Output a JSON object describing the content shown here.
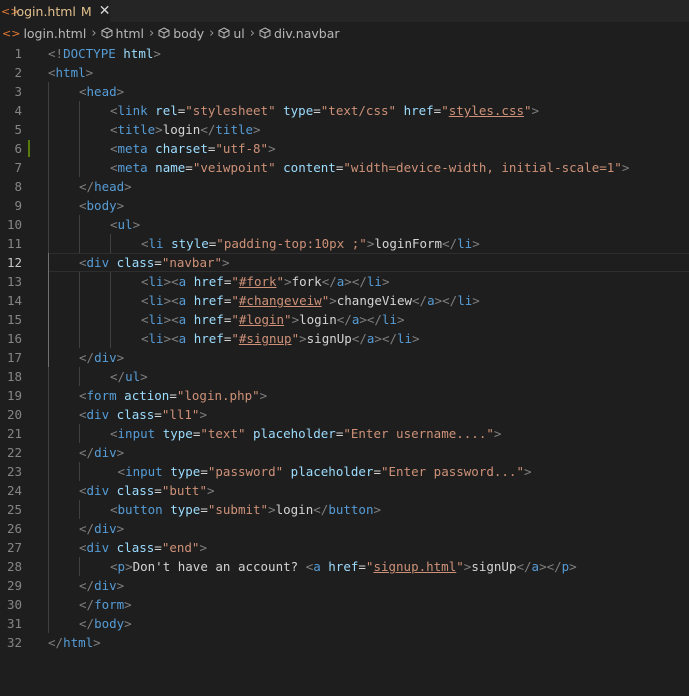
{
  "tab": {
    "icon": "<>",
    "filename": "login.html",
    "status": "M",
    "close": "✕"
  },
  "breadcrumbs": [
    {
      "icon": "html-file-icon",
      "label": "login.html"
    },
    {
      "icon": "cube-icon",
      "label": "html"
    },
    {
      "icon": "cube-icon",
      "label": "body"
    },
    {
      "icon": "cube-icon",
      "label": "ul"
    },
    {
      "icon": "cube-icon",
      "label": "div.navbar"
    }
  ],
  "active_line": 12,
  "modified_lines": [
    6
  ],
  "colors": {
    "tag": "#569cd6",
    "bracket": "#808080",
    "attr": "#9cdcfe",
    "string": "#ce9178",
    "text": "#d4d4d4",
    "background": "#1e1e1e"
  },
  "lines": [
    {
      "num": "1",
      "indent": 0,
      "tokens": [
        [
          "br",
          "<!"
        ],
        [
          "tag",
          "DOCTYPE"
        ],
        [
          "txt",
          " "
        ],
        [
          "attr",
          "html"
        ],
        [
          "br",
          ">"
        ]
      ]
    },
    {
      "num": "2",
      "indent": 0,
      "tokens": [
        [
          "br",
          "<"
        ],
        [
          "tag",
          "html"
        ],
        [
          "br",
          ">"
        ]
      ]
    },
    {
      "num": "3",
      "indent": 1,
      "tokens": [
        [
          "br",
          "<"
        ],
        [
          "tag",
          "head"
        ],
        [
          "br",
          ">"
        ]
      ]
    },
    {
      "num": "4",
      "indent": 2,
      "tokens": [
        [
          "br",
          "<"
        ],
        [
          "tag",
          "link"
        ],
        [
          "txt",
          " "
        ],
        [
          "attr",
          "rel"
        ],
        [
          "txt",
          "="
        ],
        [
          "str",
          "\"stylesheet\""
        ],
        [
          "txt",
          " "
        ],
        [
          "attr",
          "type"
        ],
        [
          "txt",
          "="
        ],
        [
          "str",
          "\"text/css\""
        ],
        [
          "txt",
          " "
        ],
        [
          "attr",
          "href"
        ],
        [
          "txt",
          "="
        ],
        [
          "str",
          "\""
        ],
        [
          "link",
          "styles.css"
        ],
        [
          "str",
          "\""
        ],
        [
          "br",
          ">"
        ]
      ]
    },
    {
      "num": "5",
      "indent": 2,
      "tokens": [
        [
          "br",
          "<"
        ],
        [
          "tag",
          "title"
        ],
        [
          "br",
          ">"
        ],
        [
          "txt",
          "login"
        ],
        [
          "br",
          "</"
        ],
        [
          "tag",
          "title"
        ],
        [
          "br",
          ">"
        ]
      ]
    },
    {
      "num": "6",
      "indent": 2,
      "tokens": [
        [
          "br",
          "<"
        ],
        [
          "tag",
          "meta"
        ],
        [
          "txt",
          " "
        ],
        [
          "attr",
          "charset"
        ],
        [
          "txt",
          "="
        ],
        [
          "str",
          "\"utf-8\""
        ],
        [
          "br",
          ">"
        ]
      ]
    },
    {
      "num": "7",
      "indent": 2,
      "tokens": [
        [
          "br",
          "<"
        ],
        [
          "tag",
          "meta"
        ],
        [
          "txt",
          " "
        ],
        [
          "attr",
          "name"
        ],
        [
          "txt",
          "="
        ],
        [
          "str",
          "\"veiwpoint\""
        ],
        [
          "txt",
          " "
        ],
        [
          "attr",
          "content"
        ],
        [
          "txt",
          "="
        ],
        [
          "str",
          "\"width=device-width, initial-scale=1\""
        ],
        [
          "br",
          ">"
        ]
      ]
    },
    {
      "num": "8",
      "indent": 1,
      "tokens": [
        [
          "br",
          "</"
        ],
        [
          "tag",
          "head"
        ],
        [
          "br",
          ">"
        ]
      ]
    },
    {
      "num": "9",
      "indent": 1,
      "tokens": [
        [
          "br",
          "<"
        ],
        [
          "tag",
          "body"
        ],
        [
          "br",
          ">"
        ]
      ]
    },
    {
      "num": "10",
      "indent": 2,
      "tokens": [
        [
          "br",
          "<"
        ],
        [
          "tag",
          "ul"
        ],
        [
          "br",
          ">"
        ]
      ]
    },
    {
      "num": "11",
      "indent": 3,
      "tokens": [
        [
          "br",
          "<"
        ],
        [
          "tag",
          "li"
        ],
        [
          "txt",
          " "
        ],
        [
          "attr",
          "style"
        ],
        [
          "txt",
          "="
        ],
        [
          "str",
          "\"padding-top:10px ;\""
        ],
        [
          "br",
          ">"
        ],
        [
          "txt",
          "loginForm"
        ],
        [
          "br",
          "</"
        ],
        [
          "tag",
          "li"
        ],
        [
          "br",
          ">"
        ]
      ]
    },
    {
      "num": "12",
      "indent": 1,
      "tokens": [
        [
          "br",
          "<"
        ],
        [
          "tag",
          "div"
        ],
        [
          "txt",
          " "
        ],
        [
          "attr",
          "class"
        ],
        [
          "txt",
          "="
        ],
        [
          "str",
          "\"navbar\""
        ],
        [
          "br",
          ">"
        ]
      ]
    },
    {
      "num": "13",
      "indent": 3,
      "tokens": [
        [
          "br",
          "<"
        ],
        [
          "tag",
          "li"
        ],
        [
          "br",
          "><"
        ],
        [
          "tag",
          "a"
        ],
        [
          "txt",
          " "
        ],
        [
          "attr",
          "href"
        ],
        [
          "txt",
          "="
        ],
        [
          "str",
          "\""
        ],
        [
          "link",
          "#fork"
        ],
        [
          "str",
          "\""
        ],
        [
          "br",
          ">"
        ],
        [
          "txt",
          "fork"
        ],
        [
          "br",
          "</"
        ],
        [
          "tag",
          "a"
        ],
        [
          "br",
          "></"
        ],
        [
          "tag",
          "li"
        ],
        [
          "br",
          ">"
        ]
      ]
    },
    {
      "num": "14",
      "indent": 3,
      "tokens": [
        [
          "br",
          "<"
        ],
        [
          "tag",
          "li"
        ],
        [
          "br",
          "><"
        ],
        [
          "tag",
          "a"
        ],
        [
          "txt",
          " "
        ],
        [
          "attr",
          "href"
        ],
        [
          "txt",
          "="
        ],
        [
          "str",
          "\""
        ],
        [
          "link",
          "#changeveiw"
        ],
        [
          "str",
          "\""
        ],
        [
          "br",
          ">"
        ],
        [
          "txt",
          "changeView"
        ],
        [
          "br",
          "</"
        ],
        [
          "tag",
          "a"
        ],
        [
          "br",
          "></"
        ],
        [
          "tag",
          "li"
        ],
        [
          "br",
          ">"
        ]
      ]
    },
    {
      "num": "15",
      "indent": 3,
      "tokens": [
        [
          "br",
          "<"
        ],
        [
          "tag",
          "li"
        ],
        [
          "br",
          "><"
        ],
        [
          "tag",
          "a"
        ],
        [
          "txt",
          " "
        ],
        [
          "attr",
          "href"
        ],
        [
          "txt",
          "="
        ],
        [
          "str",
          "\""
        ],
        [
          "link",
          "#login"
        ],
        [
          "str",
          "\""
        ],
        [
          "br",
          ">"
        ],
        [
          "txt",
          "login"
        ],
        [
          "br",
          "</"
        ],
        [
          "tag",
          "a"
        ],
        [
          "br",
          "></"
        ],
        [
          "tag",
          "li"
        ],
        [
          "br",
          ">"
        ]
      ]
    },
    {
      "num": "16",
      "indent": 3,
      "tokens": [
        [
          "br",
          "<"
        ],
        [
          "tag",
          "li"
        ],
        [
          "br",
          "><"
        ],
        [
          "tag",
          "a"
        ],
        [
          "txt",
          " "
        ],
        [
          "attr",
          "href"
        ],
        [
          "txt",
          "="
        ],
        [
          "str",
          "\""
        ],
        [
          "link",
          "#signup"
        ],
        [
          "str",
          "\""
        ],
        [
          "br",
          ">"
        ],
        [
          "txt",
          "signUp"
        ],
        [
          "br",
          "</"
        ],
        [
          "tag",
          "a"
        ],
        [
          "br",
          "></"
        ],
        [
          "tag",
          "li"
        ],
        [
          "br",
          ">"
        ]
      ]
    },
    {
      "num": "17",
      "indent": 1,
      "tokens": [
        [
          "br",
          "</"
        ],
        [
          "tag",
          "div"
        ],
        [
          "br",
          ">"
        ]
      ]
    },
    {
      "num": "18",
      "indent": 2,
      "tokens": [
        [
          "br",
          "</"
        ],
        [
          "tag",
          "ul"
        ],
        [
          "br",
          ">"
        ]
      ]
    },
    {
      "num": "19",
      "indent": 1,
      "tokens": [
        [
          "br",
          "<"
        ],
        [
          "tag",
          "form"
        ],
        [
          "txt",
          " "
        ],
        [
          "attr",
          "action"
        ],
        [
          "txt",
          "="
        ],
        [
          "str",
          "\"login.php\""
        ],
        [
          "br",
          ">"
        ]
      ]
    },
    {
      "num": "20",
      "indent": 1,
      "tokens": [
        [
          "br",
          "<"
        ],
        [
          "tag",
          "div"
        ],
        [
          "txt",
          " "
        ],
        [
          "attr",
          "class"
        ],
        [
          "txt",
          "="
        ],
        [
          "str",
          "\"ll1\""
        ],
        [
          "br",
          ">"
        ]
      ]
    },
    {
      "num": "21",
      "indent": 2,
      "tokens": [
        [
          "br",
          "<"
        ],
        [
          "tag",
          "input"
        ],
        [
          "txt",
          " "
        ],
        [
          "attr",
          "type"
        ],
        [
          "txt",
          "="
        ],
        [
          "str",
          "\"text\""
        ],
        [
          "txt",
          " "
        ],
        [
          "attr",
          "placeholder"
        ],
        [
          "txt",
          "="
        ],
        [
          "str",
          "\"Enter username....\""
        ],
        [
          "br",
          ">"
        ]
      ]
    },
    {
      "num": "22",
      "indent": 1,
      "tokens": [
        [
          "br",
          "</"
        ],
        [
          "tag",
          "div"
        ],
        [
          "br",
          ">"
        ]
      ]
    },
    {
      "num": "23",
      "indent": 2,
      "tokens": [
        [
          "txt",
          " "
        ],
        [
          "br",
          "<"
        ],
        [
          "tag",
          "input"
        ],
        [
          "txt",
          " "
        ],
        [
          "attr",
          "type"
        ],
        [
          "txt",
          "="
        ],
        [
          "str",
          "\"password\""
        ],
        [
          "txt",
          " "
        ],
        [
          "attr",
          "placeholder"
        ],
        [
          "txt",
          "="
        ],
        [
          "str",
          "\"Enter password...\""
        ],
        [
          "br",
          ">"
        ]
      ]
    },
    {
      "num": "24",
      "indent": 1,
      "tokens": [
        [
          "br",
          "<"
        ],
        [
          "tag",
          "div"
        ],
        [
          "txt",
          " "
        ],
        [
          "attr",
          "class"
        ],
        [
          "txt",
          "="
        ],
        [
          "str",
          "\"butt\""
        ],
        [
          "br",
          ">"
        ]
      ]
    },
    {
      "num": "25",
      "indent": 2,
      "tokens": [
        [
          "br",
          "<"
        ],
        [
          "tag",
          "button"
        ],
        [
          "txt",
          " "
        ],
        [
          "attr",
          "type"
        ],
        [
          "txt",
          "="
        ],
        [
          "str",
          "\"submit\""
        ],
        [
          "br",
          ">"
        ],
        [
          "txt",
          "login"
        ],
        [
          "br",
          "</"
        ],
        [
          "tag",
          "button"
        ],
        [
          "br",
          ">"
        ]
      ]
    },
    {
      "num": "26",
      "indent": 1,
      "tokens": [
        [
          "br",
          "</"
        ],
        [
          "tag",
          "div"
        ],
        [
          "br",
          ">"
        ]
      ]
    },
    {
      "num": "27",
      "indent": 1,
      "tokens": [
        [
          "br",
          "<"
        ],
        [
          "tag",
          "div"
        ],
        [
          "txt",
          " "
        ],
        [
          "attr",
          "class"
        ],
        [
          "txt",
          "="
        ],
        [
          "str",
          "\"end\""
        ],
        [
          "br",
          ">"
        ]
      ]
    },
    {
      "num": "28",
      "indent": 2,
      "tokens": [
        [
          "br",
          "<"
        ],
        [
          "tag",
          "p"
        ],
        [
          "br",
          ">"
        ],
        [
          "txt",
          "Don't have an account? "
        ],
        [
          "br",
          "<"
        ],
        [
          "tag",
          "a"
        ],
        [
          "txt",
          " "
        ],
        [
          "attr",
          "href"
        ],
        [
          "txt",
          "="
        ],
        [
          "str",
          "\""
        ],
        [
          "link",
          "signup.html"
        ],
        [
          "str",
          "\""
        ],
        [
          "br",
          ">"
        ],
        [
          "txt",
          "signUp"
        ],
        [
          "br",
          "</"
        ],
        [
          "tag",
          "a"
        ],
        [
          "br",
          "></"
        ],
        [
          "tag",
          "p"
        ],
        [
          "br",
          ">"
        ]
      ]
    },
    {
      "num": "29",
      "indent": 1,
      "tokens": [
        [
          "br",
          "</"
        ],
        [
          "tag",
          "div"
        ],
        [
          "br",
          ">"
        ]
      ]
    },
    {
      "num": "30",
      "indent": 1,
      "tokens": [
        [
          "br",
          "</"
        ],
        [
          "tag",
          "form"
        ],
        [
          "br",
          ">"
        ]
      ]
    },
    {
      "num": "31",
      "indent": 1,
      "tokens": [
        [
          "br",
          "</"
        ],
        [
          "tag",
          "body"
        ],
        [
          "br",
          ">"
        ]
      ]
    },
    {
      "num": "32",
      "indent": 0,
      "tokens": [
        [
          "br",
          "</"
        ],
        [
          "tag",
          "html"
        ],
        [
          "br",
          ">"
        ]
      ]
    }
  ]
}
